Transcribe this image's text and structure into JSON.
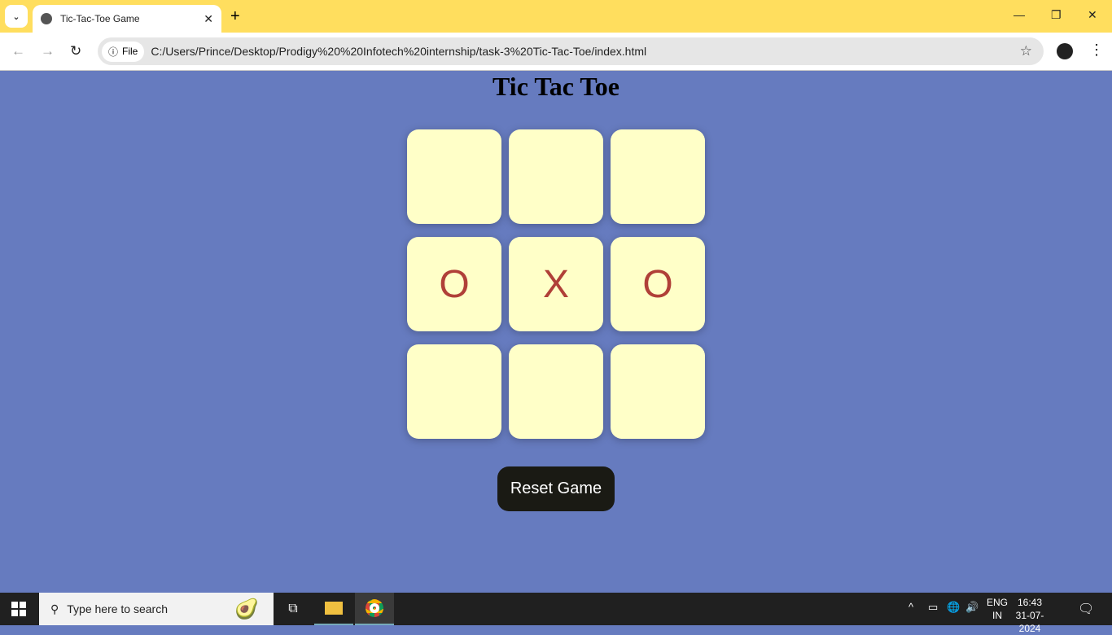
{
  "browser": {
    "tab_title": "Tic-Tac-Toe Game",
    "chip_label": "File",
    "url": "C:/Users/Prince/Desktop/Prodigy%20%20Infotech%20internship/task-3%20Tic-Tac-Toe/index.html"
  },
  "page": {
    "title": "Tic Tac Toe",
    "cells": [
      "",
      "",
      "",
      "O",
      "X",
      "O",
      "",
      "",
      ""
    ],
    "reset_label": "Reset Game",
    "mark_color": "#b04038"
  },
  "taskbar": {
    "search_placeholder": "Type here to search",
    "lang_top": "ENG",
    "lang_bottom": "IN",
    "time": "16:43",
    "date": "31-07-2024"
  }
}
